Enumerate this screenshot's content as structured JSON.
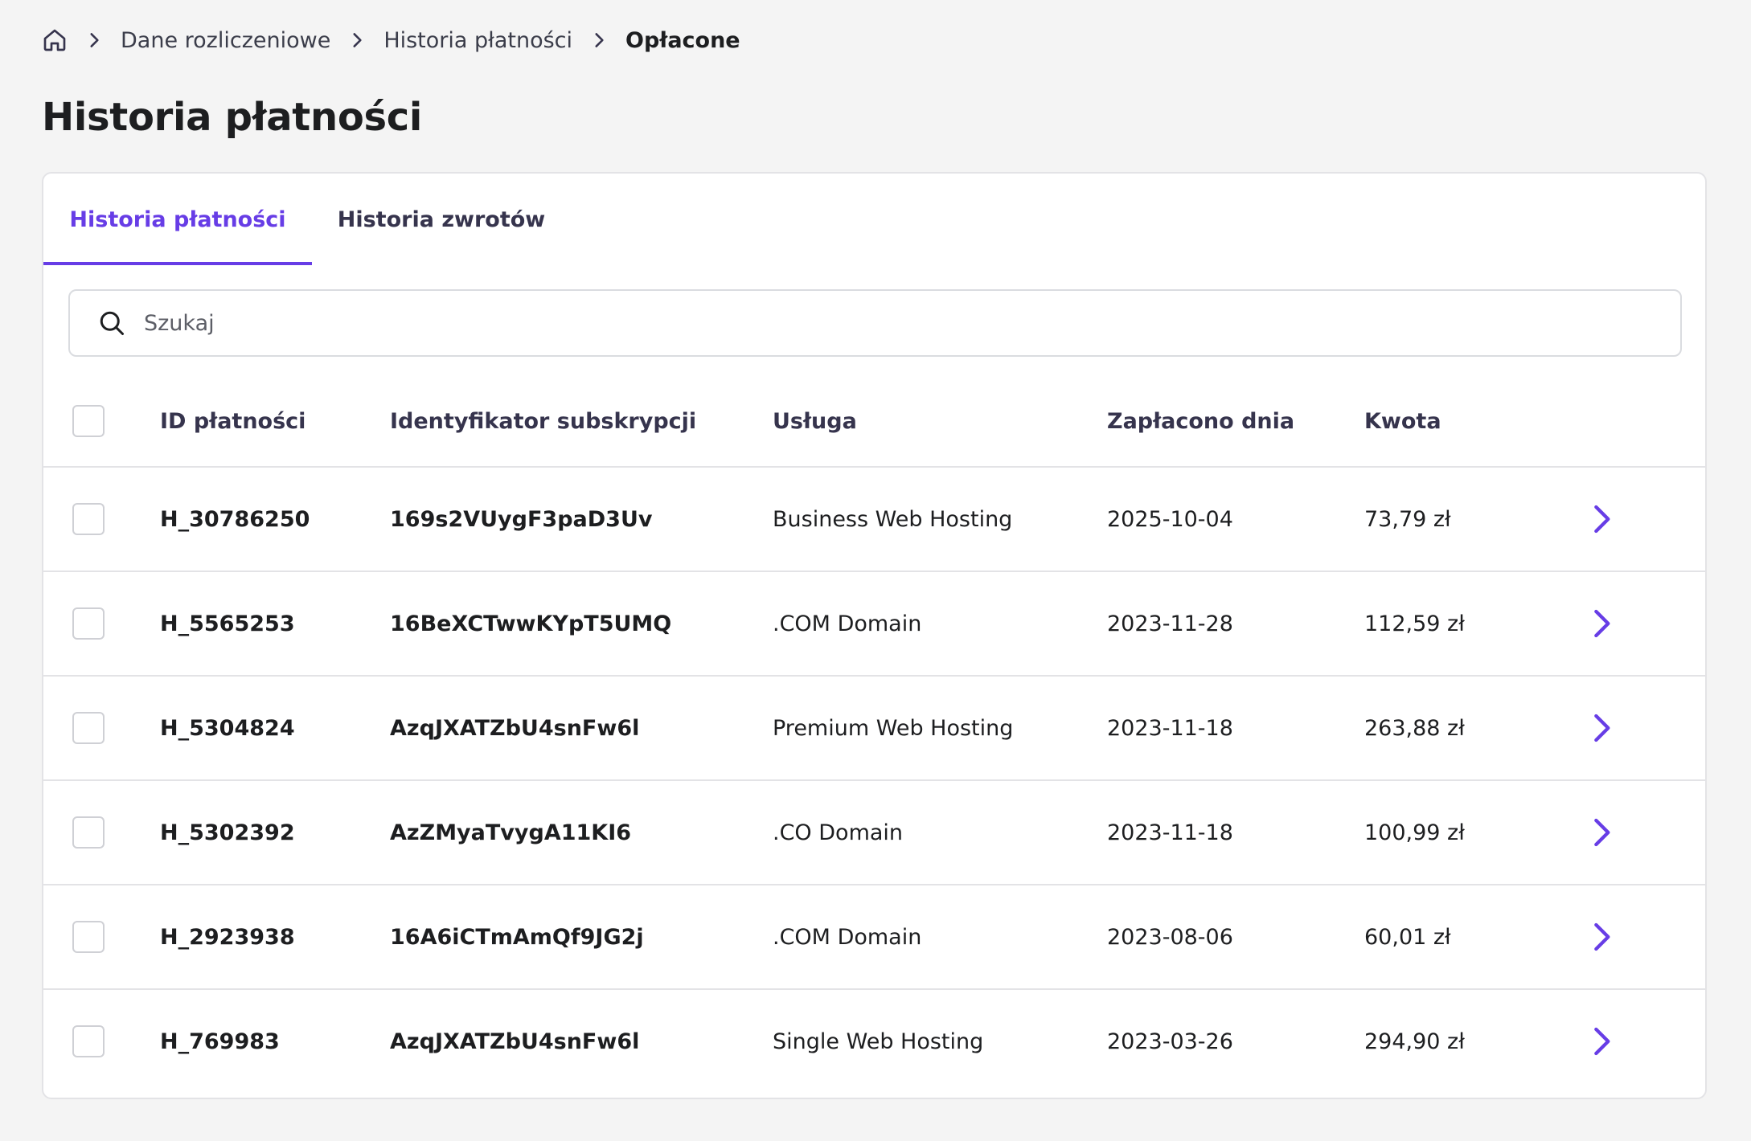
{
  "breadcrumb": {
    "items": [
      "Dane rozliczeniowe",
      "Historia płatności"
    ],
    "current": "Opłacone"
  },
  "page_title": "Historia płatności",
  "tabs": [
    {
      "label": "Historia płatności",
      "active": true
    },
    {
      "label": "Historia zwrotów",
      "active": false
    }
  ],
  "search": {
    "placeholder": "Szukaj",
    "value": ""
  },
  "table": {
    "columns": [
      "ID płatności",
      "Identyfikator subskrypcji",
      "Usługa",
      "Zapłacono dnia",
      "Kwota"
    ],
    "rows": [
      {
        "id": "H_30786250",
        "subscription": "169s2VUygF3paD3Uv",
        "service": "Business Web Hosting",
        "date": "2025-10-04",
        "amount": "73,79 zł"
      },
      {
        "id": "H_5565253",
        "subscription": "16BeXCTwwKYpT5UMQ",
        "service": ".COM Domain",
        "date": "2023-11-28",
        "amount": "112,59 zł"
      },
      {
        "id": "H_5304824",
        "subscription": "AzqJXATZbU4snFw6l",
        "service": "Premium Web Hosting",
        "date": "2023-11-18",
        "amount": "263,88 zł"
      },
      {
        "id": "H_5302392",
        "subscription": "AzZMyaTvygA11KI6",
        "service": ".CO Domain",
        "date": "2023-11-18",
        "amount": "100,99 zł"
      },
      {
        "id": "H_2923938",
        "subscription": "16A6iCTmAmQf9JG2j",
        "service": ".COM Domain",
        "date": "2023-08-06",
        "amount": "60,01 zł"
      },
      {
        "id": "H_769983",
        "subscription": "AzqJXATZbU4snFw6l",
        "service": "Single Web Hosting",
        "date": "2023-03-26",
        "amount": "294,90 zł"
      }
    ]
  },
  "colors": {
    "accent": "#673de6",
    "text": "#1d1e20",
    "border": "#e3e3e6",
    "background": "#f4f4f4"
  },
  "icons": {
    "home": "home-icon",
    "separator": "chevron-right-icon",
    "search": "search-icon",
    "row_action": "chevron-right-icon"
  }
}
